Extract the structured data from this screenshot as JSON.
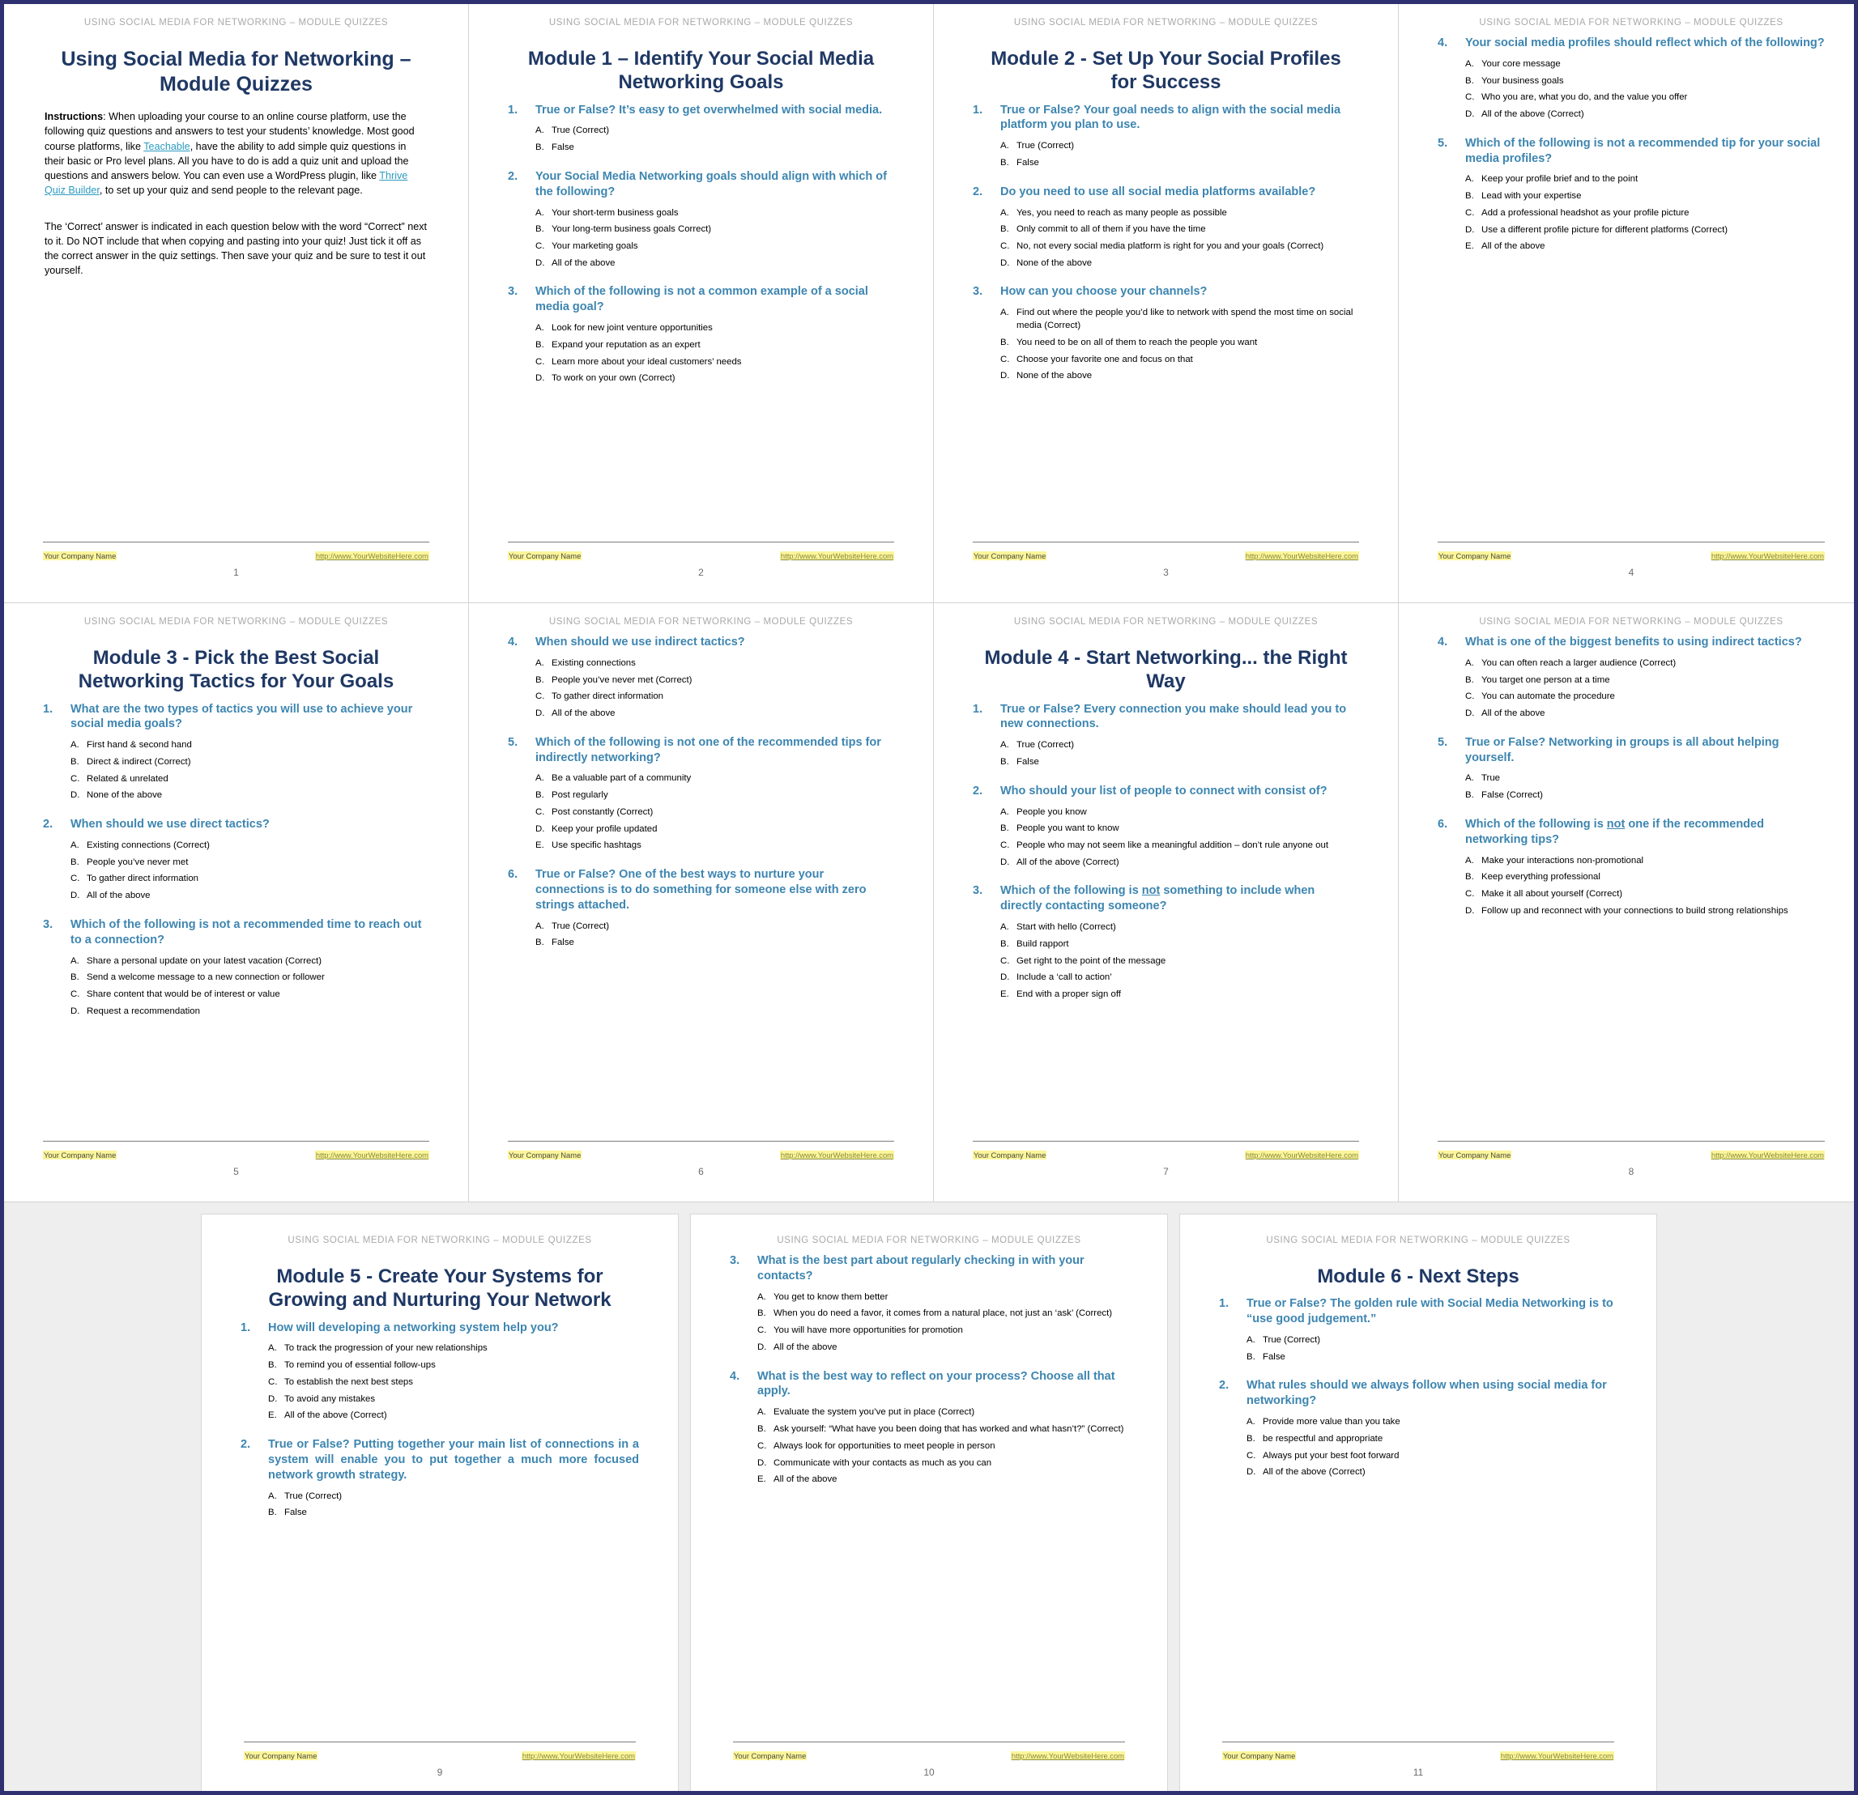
{
  "document": {
    "running_header": "USING SOCIAL MEDIA FOR NETWORKING – MODULE QUIZZES",
    "footer_company": "Your Company Name",
    "footer_url": "http://www.YourWebsiteHere.com",
    "accent_title_color": "#1f3864",
    "accent_question_color": "#3d85b0",
    "link_color": "#2e9bc0",
    "highlight_color": "#fbf59b",
    "border_color": "#2e3070"
  },
  "pages": [
    {
      "number": "1",
      "title": "Using Social Media for Networking – Module Quizzes",
      "instructions_label": "Instructions",
      "instructions_part1": ": When uploading your course to an online course platform, use the following quiz questions and answers to test your students’ knowledge. Most good course platforms, like ",
      "instructions_link1": "Teachable",
      "instructions_part2": ", have the ability to add simple quiz questions in their basic or Pro level plans. All you have to do is add a quiz unit and upload the questions and answers below. You can even use a WordPress plugin, like ",
      "instructions_link2": "Thrive Quiz Builder",
      "instructions_part3": ", to set up your quiz and send people to the relevant page.",
      "instructions_para2": "The ‘Correct’ answer is indicated in each question below with the word “Correct” next to it. Do NOT include that when copying and pasting into your quiz! Just tick it off as the correct answer in the quiz settings. Then save your quiz and be sure to test it out yourself."
    },
    {
      "number": "2",
      "title": "Module 1 – Identify Your Social Media Networking Goals",
      "questions": [
        {
          "num": "1.",
          "text": "True or False? It’s easy to get overwhelmed with social media.",
          "answers": [
            {
              "letter": "A.",
              "text": "True (Correct)"
            },
            {
              "letter": "B.",
              "text": "False"
            }
          ]
        },
        {
          "num": "2.",
          "text": "Your Social Media Networking goals should align with which of the following?",
          "answers": [
            {
              "letter": "A.",
              "text": "Your short-term business goals"
            },
            {
              "letter": "B.",
              "text": "Your long-term business goals Correct)"
            },
            {
              "letter": "C.",
              "text": "Your marketing goals"
            },
            {
              "letter": "D.",
              "text": "All of the above"
            }
          ]
        },
        {
          "num": "3.",
          "text": "Which of the following is not a common example of a social media goal?",
          "answers": [
            {
              "letter": "A.",
              "text": "Look for new joint venture opportunities"
            },
            {
              "letter": "B.",
              "text": "Expand your reputation as an expert"
            },
            {
              "letter": "C.",
              "text": "Learn more about your ideal customers’ needs"
            },
            {
              "letter": "D.",
              "text": "To work on your own (Correct)"
            }
          ]
        }
      ]
    },
    {
      "number": "3",
      "title": "Module 2 - Set Up Your Social Profiles for Success",
      "questions": [
        {
          "num": "1.",
          "text": "True or False? Your goal needs to align with the social media platform you plan to use.",
          "answers": [
            {
              "letter": "A.",
              "text": "True (Correct)"
            },
            {
              "letter": "B.",
              "text": "False"
            }
          ]
        },
        {
          "num": "2.",
          "text": "Do you need to use all social media platforms available?",
          "answers": [
            {
              "letter": "A.",
              "text": "Yes, you need to reach as many people as possible"
            },
            {
              "letter": "B.",
              "text": "Only commit to all of them if you have the time"
            },
            {
              "letter": "C.",
              "text": "No, not every social media platform is right for you and your goals (Correct)"
            },
            {
              "letter": "D.",
              "text": "None of the above"
            }
          ]
        },
        {
          "num": "3.",
          "text": "How can you choose your channels?",
          "answers": [
            {
              "letter": "A.",
              "text": "Find out where the people you’d like to network with spend the most time on social media (Correct)"
            },
            {
              "letter": "B.",
              "text": "You need to be on all of them to reach the people you want"
            },
            {
              "letter": "C.",
              "text": "Choose your favorite one and focus on that"
            },
            {
              "letter": "D.",
              "text": "None of the above"
            }
          ]
        }
      ]
    },
    {
      "number": "4",
      "title": "",
      "questions": [
        {
          "num": "4.",
          "text": "Your social media profiles should reflect which of the following?",
          "answers": [
            {
              "letter": "A.",
              "text": "Your core message"
            },
            {
              "letter": "B.",
              "text": "Your business goals"
            },
            {
              "letter": "C.",
              "text": "Who you are, what you do, and the value you offer"
            },
            {
              "letter": "D.",
              "text": "All of the above (Correct)"
            }
          ]
        },
        {
          "num": "5.",
          "text": "Which of the following is not a recommended tip for your social media profiles?",
          "answers": [
            {
              "letter": "A.",
              "text": "Keep your profile brief and to the point"
            },
            {
              "letter": "B.",
              "text": "Lead with your expertise"
            },
            {
              "letter": "C.",
              "text": "Add a professional headshot as your profile picture"
            },
            {
              "letter": "D.",
              "text": "Use a different profile picture for different platforms (Correct)"
            },
            {
              "letter": "E.",
              "text": "All of the above"
            }
          ]
        }
      ]
    },
    {
      "number": "5",
      "title": "Module 3 - Pick the Best Social Networking Tactics for Your Goals",
      "questions": [
        {
          "num": "1.",
          "text": "What are the two types of tactics you will use to achieve your social media goals?",
          "answers": [
            {
              "letter": "A.",
              "text": "First hand & second hand"
            },
            {
              "letter": "B.",
              "text": "Direct & indirect (Correct)"
            },
            {
              "letter": "C.",
              "text": "Related & unrelated"
            },
            {
              "letter": "D.",
              "text": "None of the above"
            }
          ]
        },
        {
          "num": "2.",
          "text": "When should we use direct tactics?",
          "answers": [
            {
              "letter": "A.",
              "text": "Existing connections (Correct)"
            },
            {
              "letter": "B.",
              "text": "People you’ve never met"
            },
            {
              "letter": "C.",
              "text": "To gather direct information"
            },
            {
              "letter": "D.",
              "text": "All of the above"
            }
          ]
        },
        {
          "num": "3.",
          "text": "Which of the following is not a recommended time to reach out to a connection?",
          "answers": [
            {
              "letter": "A.",
              "text": "Share a personal update on your latest vacation (Correct)"
            },
            {
              "letter": "B.",
              "text": "Send a welcome message to a new connection or follower"
            },
            {
              "letter": "C.",
              "text": "Share content that would be of interest or value"
            },
            {
              "letter": "D.",
              "text": "Request a recommendation"
            }
          ]
        }
      ]
    },
    {
      "number": "6",
      "title": "",
      "questions": [
        {
          "num": "4.",
          "text": "When should we use indirect tactics?",
          "answers": [
            {
              "letter": "A.",
              "text": "Existing connections"
            },
            {
              "letter": "B.",
              "text": "People you’ve never met (Correct)"
            },
            {
              "letter": "C.",
              "text": "To gather direct information"
            },
            {
              "letter": "D.",
              "text": "All of the above"
            }
          ]
        },
        {
          "num": "5.",
          "text": "Which of the following is not one of the recommended tips for indirectly networking?",
          "answers": [
            {
              "letter": "A.",
              "text": "Be a valuable part of a community"
            },
            {
              "letter": "B.",
              "text": "Post regularly"
            },
            {
              "letter": "C.",
              "text": "Post constantly (Correct)"
            },
            {
              "letter": "D.",
              "text": "Keep your profile updated"
            },
            {
              "letter": "E.",
              "text": "Use specific hashtags"
            }
          ]
        },
        {
          "num": "6.",
          "text": "True or False? One of the best ways to nurture your connections is to do something for someone else with zero strings attached.",
          "answers": [
            {
              "letter": "A.",
              "text": "True (Correct)"
            },
            {
              "letter": "B.",
              "text": "False"
            }
          ]
        }
      ]
    },
    {
      "number": "7",
      "title": "Module 4 - Start Networking... the Right Way",
      "questions": [
        {
          "num": "1.",
          "text": "True or False? Every connection you make should lead you to new connections.",
          "answers": [
            {
              "letter": "A.",
              "text": "True (Correct)"
            },
            {
              "letter": "B.",
              "text": "False"
            }
          ]
        },
        {
          "num": "2.",
          "text": "Who should your list of people to connect with consist of?",
          "answers": [
            {
              "letter": "A.",
              "text": "People you know"
            },
            {
              "letter": "B.",
              "text": "People you want to know"
            },
            {
              "letter": "C.",
              "text": "People who may not seem like a meaningful addition – don’t rule anyone out"
            },
            {
              "letter": "D.",
              "text": "All of the above (Correct)"
            }
          ]
        },
        {
          "num": "3.",
          "text_pre": "Which of the following is ",
          "text_underline": "not",
          "text_post": " something to include when directly contacting someone?",
          "text": "Which of the following is not something to include when directly contacting someone?",
          "answers": [
            {
              "letter": "A.",
              "text": "Start with hello (Correct)"
            },
            {
              "letter": "B.",
              "text": "Build rapport"
            },
            {
              "letter": "C.",
              "text": "Get right to the point of the message"
            },
            {
              "letter": "D.",
              "text": "Include a ‘call to action’"
            },
            {
              "letter": "E.",
              "text": "End with a proper sign off"
            }
          ]
        }
      ]
    },
    {
      "number": "8",
      "title": "",
      "questions": [
        {
          "num": "4.",
          "text": "What is one of the biggest benefits to using indirect tactics?",
          "answers": [
            {
              "letter": "A.",
              "text": "You can often reach a larger audience (Correct)"
            },
            {
              "letter": "B.",
              "text": "You target one person at a time"
            },
            {
              "letter": "C.",
              "text": "You can automate the procedure"
            },
            {
              "letter": "D.",
              "text": "All of the above"
            }
          ]
        },
        {
          "num": "5.",
          "text": "True or False? Networking in groups is all about helping yourself.",
          "answers": [
            {
              "letter": "A.",
              "text": "True"
            },
            {
              "letter": "B.",
              "text": "False (Correct)"
            }
          ]
        },
        {
          "num": "6.",
          "text_pre": "Which of the following is ",
          "text_underline": "not",
          "text_post": " one if the recommended networking tips?",
          "text": "Which of the following is not one if the recommended networking tips?",
          "answers": [
            {
              "letter": "A.",
              "text": "Make your interactions non-promotional"
            },
            {
              "letter": "B.",
              "text": "Keep everything professional"
            },
            {
              "letter": "C.",
              "text": "Make it all about yourself (Correct)"
            },
            {
              "letter": "D.",
              "text": "Follow up and reconnect with your connections to build strong relationships"
            }
          ]
        }
      ]
    },
    {
      "number": "9",
      "title": "Module 5 - Create Your Systems for Growing and Nurturing Your Network",
      "questions": [
        {
          "num": "1.",
          "text": "How will developing a networking system help you?",
          "answers": [
            {
              "letter": "A.",
              "text": "To track the progression of your new relationships"
            },
            {
              "letter": "B.",
              "text": "To remind you of essential follow-ups"
            },
            {
              "letter": "C.",
              "text": "To establish the next best steps"
            },
            {
              "letter": "D.",
              "text": "To avoid any mistakes"
            },
            {
              "letter": "E.",
              "text": "All of the above (Correct)"
            }
          ]
        },
        {
          "num": "2.",
          "text": "True or False? Putting together your main list of connections in a system will enable you to put together a much more focused network growth strategy.",
          "justify": true,
          "answers": [
            {
              "letter": "A.",
              "text": "True (Correct)"
            },
            {
              "letter": "B.",
              "text": "False"
            }
          ]
        }
      ]
    },
    {
      "number": "10",
      "title": "",
      "questions": [
        {
          "num": "3.",
          "text": "What is the best part about regularly checking in with your contacts?",
          "answers": [
            {
              "letter": "A.",
              "text": "You get to know them better"
            },
            {
              "letter": "B.",
              "text": "When you do need a favor, it comes from a natural place, not just an ‘ask’ (Correct)"
            },
            {
              "letter": "C.",
              "text": "You will have more opportunities for promotion"
            },
            {
              "letter": "D.",
              "text": "All of the above"
            }
          ]
        },
        {
          "num": "4.",
          "text": "What is the best way to reflect on your process? Choose all that apply.",
          "answers": [
            {
              "letter": "A.",
              "text": "Evaluate the system you’ve put in place (Correct)"
            },
            {
              "letter": "B.",
              "text": "Ask yourself: “What have you been doing that has worked and what hasn’t?” (Correct)"
            },
            {
              "letter": "C.",
              "text": "Always look for opportunities to meet people in person"
            },
            {
              "letter": "D.",
              "text": "Communicate with your contacts as much as you can"
            },
            {
              "letter": "E.",
              "text": "All of the above"
            }
          ]
        }
      ]
    },
    {
      "number": "11",
      "title": "Module 6 - Next Steps",
      "questions": [
        {
          "num": "1.",
          "text": "True or False? The golden rule with Social Media Networking is to “use good judgement.”",
          "answers": [
            {
              "letter": "A.",
              "text": "True (Correct)"
            },
            {
              "letter": "B.",
              "text": "False"
            }
          ]
        },
        {
          "num": "2.",
          "text": "What rules should we always follow when using social media for networking?",
          "answers": [
            {
              "letter": "A.",
              "text": "Provide more value than you take"
            },
            {
              "letter": "B.",
              "text": "be respectful and appropriate"
            },
            {
              "letter": "C.",
              "text": "Always put your best foot forward"
            },
            {
              "letter": "D.",
              "text": "All of the above (Correct)"
            }
          ]
        }
      ]
    }
  ]
}
